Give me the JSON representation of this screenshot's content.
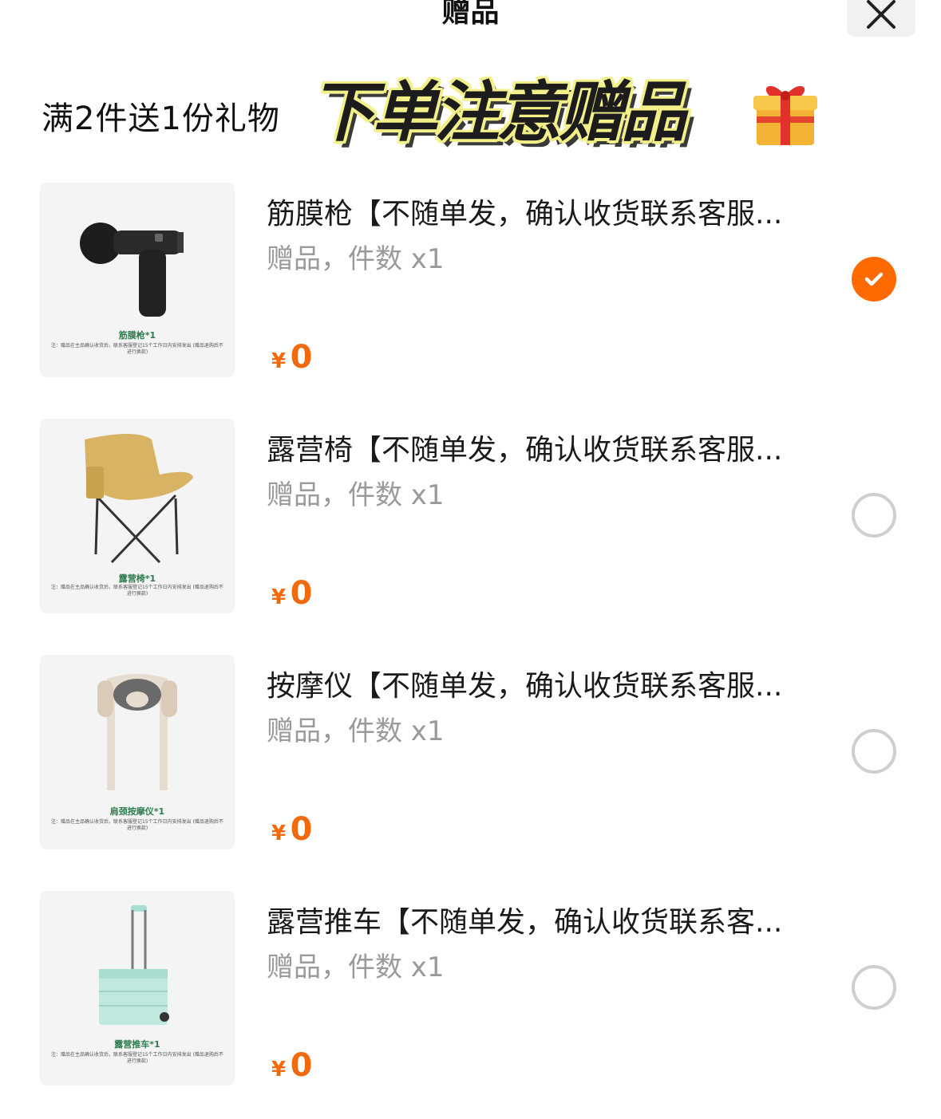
{
  "header": {
    "title": "赠品",
    "close_icon": "close-icon"
  },
  "promo": {
    "text": "满2件送1份礼物",
    "banner": "下单注意赠品",
    "icon": "gift-icon"
  },
  "colors": {
    "accent": "#ff6a00",
    "price": "#f26a10",
    "muted": "#9a9a9a"
  },
  "items": [
    {
      "name": "筋膜枪【不随单发，确认收货联系客服...",
      "meta": "赠品，件数 x1",
      "currency": "¥",
      "price": "0",
      "selected": true,
      "thumb_caption": "筋膜枪*1",
      "thumb_note": "注：赠品在主品确认收货后，联系客服登记15个工作日内安排发出 (赠品退购后不进行换款)"
    },
    {
      "name": "露营椅【不随单发，确认收货联系客服...",
      "meta": "赠品，件数 x1",
      "currency": "¥",
      "price": "0",
      "selected": false,
      "thumb_caption": "露营椅*1",
      "thumb_note": "注：赠品在主品确认收货后，联系客服登记15个工作日内安排发出 (赠品退购后不进行换款)"
    },
    {
      "name": "按摩仪【不随单发，确认收货联系客服...",
      "meta": "赠品，件数 x1",
      "currency": "¥",
      "price": "0",
      "selected": false,
      "thumb_caption": "肩颈按摩仪*1",
      "thumb_note": "注：赠品在主品确认收货后，联系客服登记15个工作日内安排发出 (赠品退购后不进行换款)"
    },
    {
      "name": "露营推车【不随单发，确认收货联系客...",
      "meta": "赠品，件数 x1",
      "currency": "¥",
      "price": "0",
      "selected": false,
      "thumb_caption": "露营推车*1",
      "thumb_note": "注：赠品在主品确认收货后，联系客服登记15个工作日内安排发出 (赠品退购后不进行换款)"
    }
  ]
}
